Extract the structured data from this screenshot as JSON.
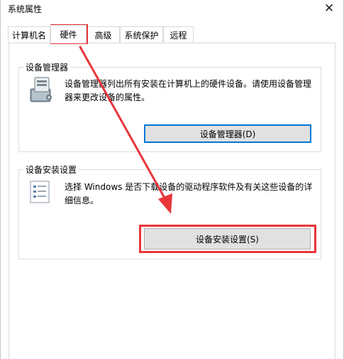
{
  "window": {
    "title": "系统属性"
  },
  "tabs": [
    {
      "label": "计算机名",
      "active": false
    },
    {
      "label": "硬件",
      "active": true
    },
    {
      "label": "高级",
      "active": false
    },
    {
      "label": "系统保护",
      "active": false
    },
    {
      "label": "远程",
      "active": false
    }
  ],
  "device_manager": {
    "group_label": "设备管理器",
    "description": "设备管理器列出所有安装在计算机上的硬件设备。请使用设备管理器来更改设备的属性。",
    "button_label": "设备管理器(D)",
    "icon": "device-manager-icon"
  },
  "device_install": {
    "group_label": "设备安装设置",
    "description": "选择 Windows 是否下载设备的驱动程序软件及有关这些设备的详细信息。",
    "button_label": "设备安装设置(S)",
    "icon": "checklist-icon"
  },
  "colors": {
    "annotation": "#e8363b",
    "focus": "#0078d7"
  }
}
